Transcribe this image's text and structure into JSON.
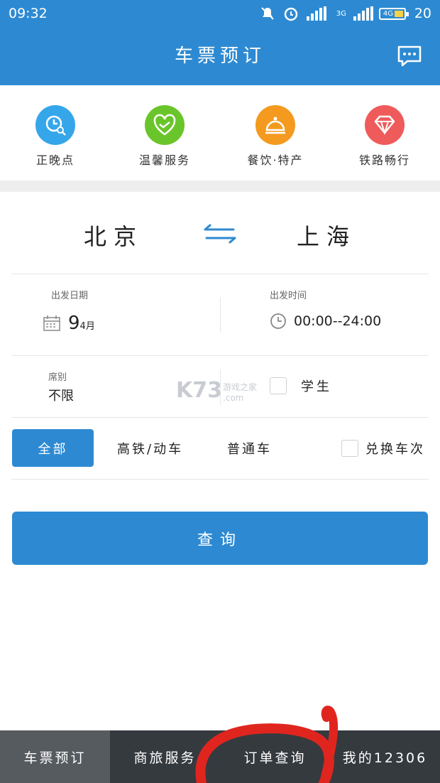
{
  "status_bar": {
    "time": "09:32",
    "signal_1_label": "3G",
    "signal_2_label": "4G",
    "battery_level": "20"
  },
  "header": {
    "title": "车票预订",
    "message_icon": "chat-icon"
  },
  "quick_actions": [
    {
      "label": "正晚点",
      "icon": "clock-search-icon",
      "color": "#36a6ea"
    },
    {
      "label": "温馨服务",
      "icon": "handshake-heart-icon",
      "color": "#6ac52a"
    },
    {
      "label": "餐饮·特产",
      "icon": "food-cloche-icon",
      "color": "#f39a1f"
    },
    {
      "label": "铁路畅行",
      "icon": "diamond-icon",
      "color": "#ef5b5b"
    }
  ],
  "route": {
    "from": "北京",
    "to": "上海",
    "swap_icon": "swap-arrows-icon"
  },
  "departure_date": {
    "label": "出发日期",
    "day": "9",
    "month": "4月"
  },
  "departure_time": {
    "label": "出发时间",
    "value": "00:00--24:00"
  },
  "seat": {
    "label": "席别",
    "value": "不限"
  },
  "student": {
    "label": "学生",
    "checked": false
  },
  "watermark": {
    "logo": "K73",
    "sub": "游戏之家",
    "domain": ".com"
  },
  "train_filters": {
    "all": "全部",
    "high_speed": "高铁/动车",
    "normal": "普通车",
    "exchange": "兑换车次"
  },
  "query_button": "查询",
  "bottom_nav": [
    {
      "label": "车票预订",
      "active": true
    },
    {
      "label": "商旅服务",
      "active": false
    },
    {
      "label": "订单查询",
      "active": false
    },
    {
      "label": "我的12306",
      "active": false
    }
  ],
  "colors": {
    "primary": "#2d8ad2",
    "nav_bg": "#353a3f",
    "nav_active": "#565b60",
    "annotation": "#e0251f"
  }
}
